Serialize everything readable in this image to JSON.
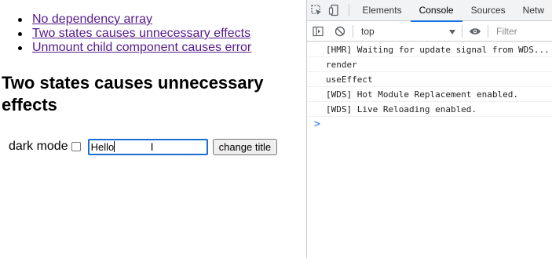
{
  "page": {
    "nav_links": [
      {
        "label": "No dependency array"
      },
      {
        "label": "Two states causes unnecessary effects"
      },
      {
        "label": "Unmount child component causes error"
      }
    ],
    "heading": "Two states causes unnecessary effects",
    "dark_mode_label": "dark mode",
    "dark_mode_checked": false,
    "title_input_value": "Hello",
    "change_title_button": "change title"
  },
  "devtools": {
    "tabs": [
      {
        "label": "Elements",
        "active": false
      },
      {
        "label": "Console",
        "active": true
      },
      {
        "label": "Sources",
        "active": false
      },
      {
        "label": "Netw",
        "active": false
      }
    ],
    "context": "top",
    "filter_placeholder": "Filter",
    "console_lines": [
      "[HMR] Waiting for update signal from WDS...",
      "render",
      "useEffect",
      "[WDS] Hot Module Replacement enabled.",
      "[WDS] Live Reloading enabled."
    ],
    "prompt_symbol": ">"
  },
  "colors": {
    "link": "#551a8b",
    "focus_ring": "#1a6fd1",
    "devtools_accent": "#1a73e8"
  },
  "icons": [
    "inspect-element-icon",
    "device-toolbar-icon",
    "sidebar-toggle-icon",
    "clear-console-icon",
    "dropdown-arrow-icon",
    "eye-icon",
    "text-cursor-icon"
  ]
}
